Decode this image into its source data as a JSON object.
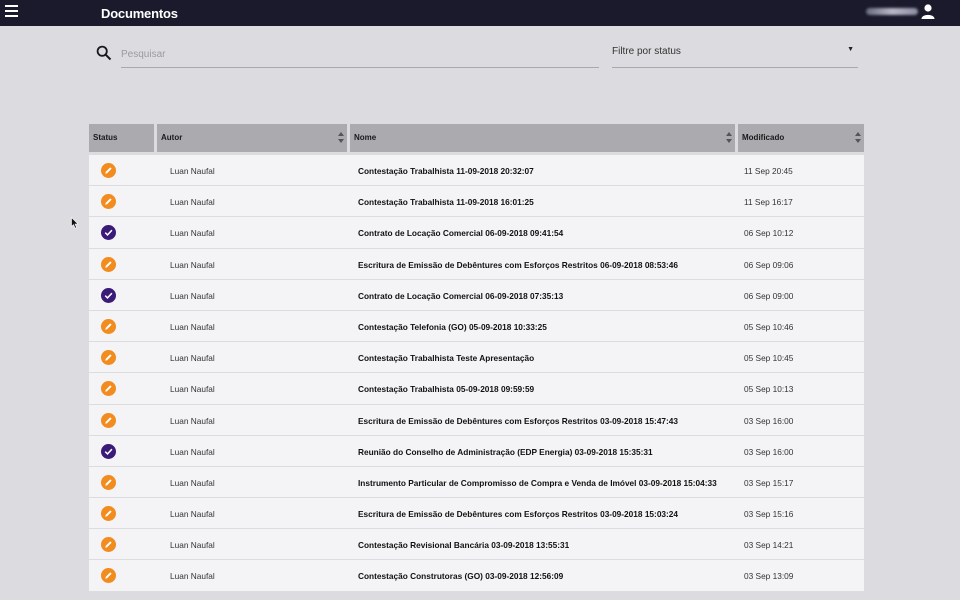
{
  "header": {
    "title": "Documentos"
  },
  "search": {
    "placeholder": "Pesquisar"
  },
  "filter": {
    "label": "Filtre por status"
  },
  "colors": {
    "appbar": "#1b1a2c",
    "draft": "#f28c1f",
    "signed": "#3b1b78"
  },
  "table": {
    "columns": [
      "Status",
      "Autor",
      "Nome",
      "Modificado"
    ],
    "rows": [
      {
        "status": "draft",
        "author": "Luan Naufal",
        "name": "Contestação Trabalhista 11-09-2018 20:32:07",
        "modified": "11 Sep 20:45"
      },
      {
        "status": "draft",
        "author": "Luan Naufal",
        "name": "Contestação Trabalhista 11-09-2018 16:01:25",
        "modified": "11 Sep 16:17"
      },
      {
        "status": "signed",
        "author": "Luan Naufal",
        "name": "Contrato de Locação Comercial 06-09-2018 09:41:54",
        "modified": "06 Sep 10:12"
      },
      {
        "status": "draft",
        "author": "Luan Naufal",
        "name": "Escritura de Emissão de Debêntures com Esforços Restritos 06-09-2018 08:53:46",
        "modified": "06 Sep 09:06"
      },
      {
        "status": "signed",
        "author": "Luan Naufal",
        "name": "Contrato de Locação Comercial 06-09-2018 07:35:13",
        "modified": "06 Sep 09:00"
      },
      {
        "status": "draft",
        "author": "Luan Naufal",
        "name": "Contestação Telefonia (GO) 05-09-2018 10:33:25",
        "modified": "05 Sep 10:46"
      },
      {
        "status": "draft",
        "author": "Luan Naufal",
        "name": "Contestação Trabalhista Teste Apresentação",
        "modified": "05 Sep 10:45"
      },
      {
        "status": "draft",
        "author": "Luan Naufal",
        "name": "Contestação Trabalhista 05-09-2018 09:59:59",
        "modified": "05 Sep 10:13"
      },
      {
        "status": "draft",
        "author": "Luan Naufal",
        "name": "Escritura de Emissão de Debêntures com Esforços Restritos 03-09-2018 15:47:43",
        "modified": "03 Sep 16:00"
      },
      {
        "status": "signed",
        "author": "Luan Naufal",
        "name": "Reunião do Conselho de Administração (EDP Energia) 03-09-2018 15:35:31",
        "modified": "03 Sep 16:00"
      },
      {
        "status": "draft",
        "author": "Luan Naufal",
        "name": "Instrumento Particular de Compromisso de Compra e Venda de Imóvel 03-09-2018 15:04:33",
        "modified": "03 Sep 15:17"
      },
      {
        "status": "draft",
        "author": "Luan Naufal",
        "name": "Escritura de Emissão de Debêntures com Esforços Restritos 03-09-2018 15:03:24",
        "modified": "03 Sep 15:16"
      },
      {
        "status": "draft",
        "author": "Luan Naufal",
        "name": "Contestação Revisional Bancária 03-09-2018 13:55:31",
        "modified": "03 Sep 14:21"
      },
      {
        "status": "draft",
        "author": "Luan Naufal",
        "name": "Contestação Construtoras (GO) 03-09-2018 12:56:09",
        "modified": "03 Sep 13:09"
      }
    ]
  }
}
